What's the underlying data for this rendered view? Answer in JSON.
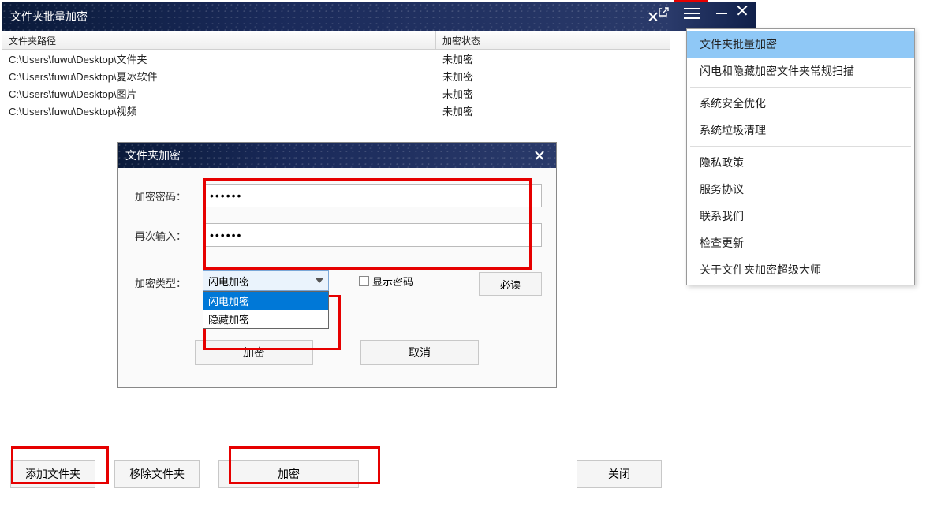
{
  "main_window": {
    "title": "文件夹批量加密",
    "columns": {
      "path": "文件夹路径",
      "status": "加密状态"
    },
    "rows": [
      {
        "path": "C:\\Users\\fuwu\\Desktop\\文件夹",
        "status": "未加密"
      },
      {
        "path": "C:\\Users\\fuwu\\Desktop\\夏冰软件",
        "status": "未加密"
      },
      {
        "path": "C:\\Users\\fuwu\\Desktop\\图片",
        "status": "未加密"
      },
      {
        "path": "C:\\Users\\fuwu\\Desktop\\视频",
        "status": "未加密"
      }
    ],
    "buttons": {
      "add_folder": "添加文件夹",
      "remove_folder": "移除文件夹",
      "encrypt": "加密",
      "close": "关闭"
    }
  },
  "dialog": {
    "title": "文件夹加密",
    "labels": {
      "password": "加密密码：",
      "password_again": "再次输入：",
      "type": "加密类型：",
      "show_password": "显示密码",
      "must_read": "必读"
    },
    "password_value": "••••••",
    "password_again_value": "••••••",
    "type_selected": "闪电加密",
    "type_options": [
      "闪电加密",
      "隐藏加密"
    ],
    "buttons": {
      "encrypt": "加密",
      "cancel": "取消"
    }
  },
  "menu": {
    "items": [
      "文件夹批量加密",
      "闪电和隐藏加密文件夹常规扫描",
      "系统安全优化",
      "系统垃圾清理",
      "隐私政策",
      "服务协议",
      "联系我们",
      "检查更新",
      "关于文件夹加密超级大师"
    ],
    "selected_index": 0,
    "separators_after": [
      1,
      3
    ]
  }
}
